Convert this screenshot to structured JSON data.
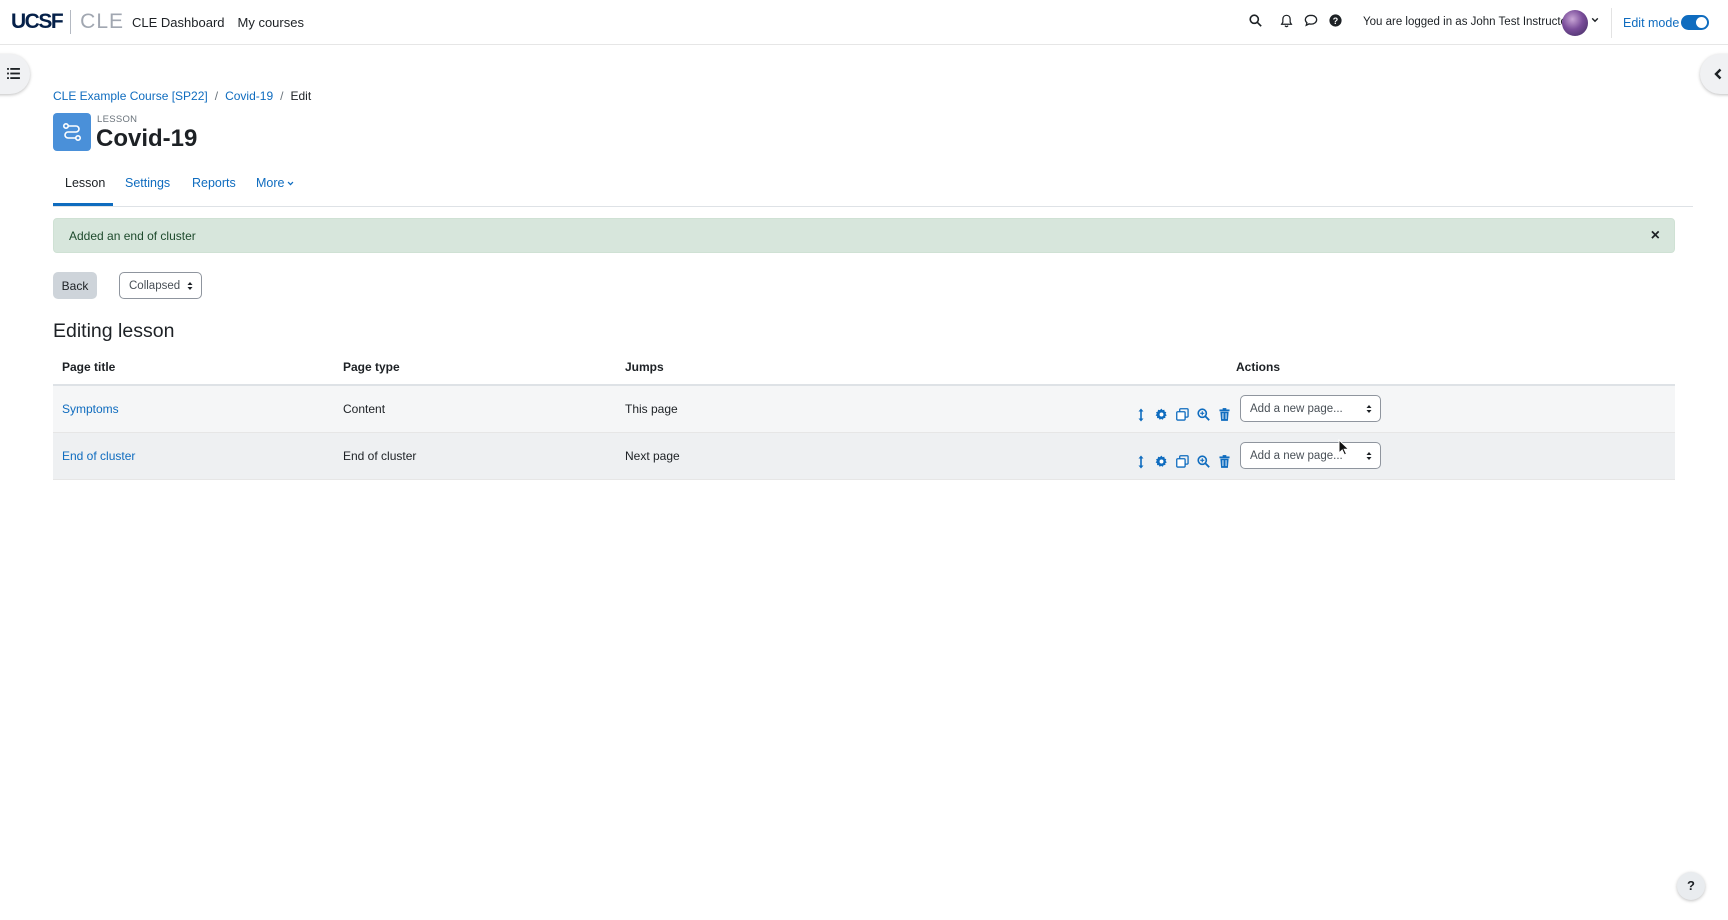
{
  "navbar": {
    "logo_ucsf": "UCSF",
    "logo_cle": "CLE",
    "links": [
      "CLE Dashboard",
      "My courses"
    ],
    "user_text": "You are logged in as John Test Instructor",
    "edit_mode_label": "Edit mode",
    "edit_mode_on": true,
    "icons": [
      "search-icon",
      "bell-icon",
      "chat-icon",
      "help-icon",
      "avatar",
      "chevron-down-icon"
    ]
  },
  "breadcrumb": {
    "items": [
      "CLE Example Course [SP22]",
      "Covid-19",
      "Edit"
    ],
    "separator": "/"
  },
  "header": {
    "activity_type": "LESSON",
    "title": "Covid-19"
  },
  "tabs": [
    {
      "label": "Lesson",
      "active": true
    },
    {
      "label": "Settings",
      "active": false
    },
    {
      "label": "Reports",
      "active": false
    },
    {
      "label": "More",
      "active": false
    }
  ],
  "alert": {
    "message": "Added an end of cluster",
    "close_label": "×"
  },
  "controls": {
    "back_label": "Back",
    "view_select": "Collapsed"
  },
  "section_title": "Editing lesson",
  "table": {
    "columns": [
      "Page title",
      "Page type",
      "Jumps",
      "Actions"
    ],
    "rows": [
      {
        "title": "Symptoms",
        "type": "Content",
        "jumps": "This page",
        "add_page_placeholder": "Add a new page..."
      },
      {
        "title": "End of cluster",
        "type": "End of cluster",
        "jumps": "Next page",
        "add_page_placeholder": "Add a new page..."
      }
    ],
    "action_icons": [
      "move-icon",
      "gear-icon",
      "copy-icon",
      "preview-icon",
      "trash-icon"
    ]
  },
  "help_button": "?",
  "colors": {
    "link": "#0f6cbf",
    "alert_bg": "#d7e6dc",
    "activity_icon": "#4a90d9"
  }
}
